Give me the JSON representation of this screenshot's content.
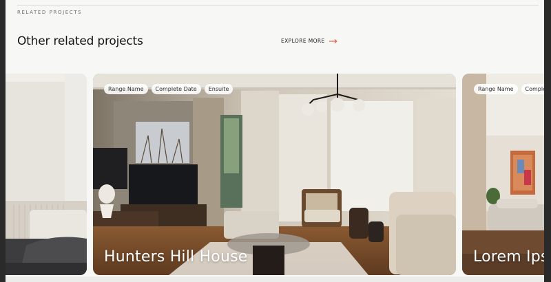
{
  "section": {
    "eyebrow": "RELATED PROJECTS",
    "heading": "Other related projects",
    "explore_label": "EXPLORE MORE",
    "explore_icon": "arrow-right-icon",
    "accent_color": "#e8522e"
  },
  "projects": [
    {
      "title": "Hunters Hill House",
      "tags": [
        "Range Name",
        "Complete Date",
        "Ensuite"
      ]
    },
    {
      "title": "Lorem Ipsum",
      "tags": [
        "Range Name",
        "Complete Date"
      ]
    }
  ]
}
